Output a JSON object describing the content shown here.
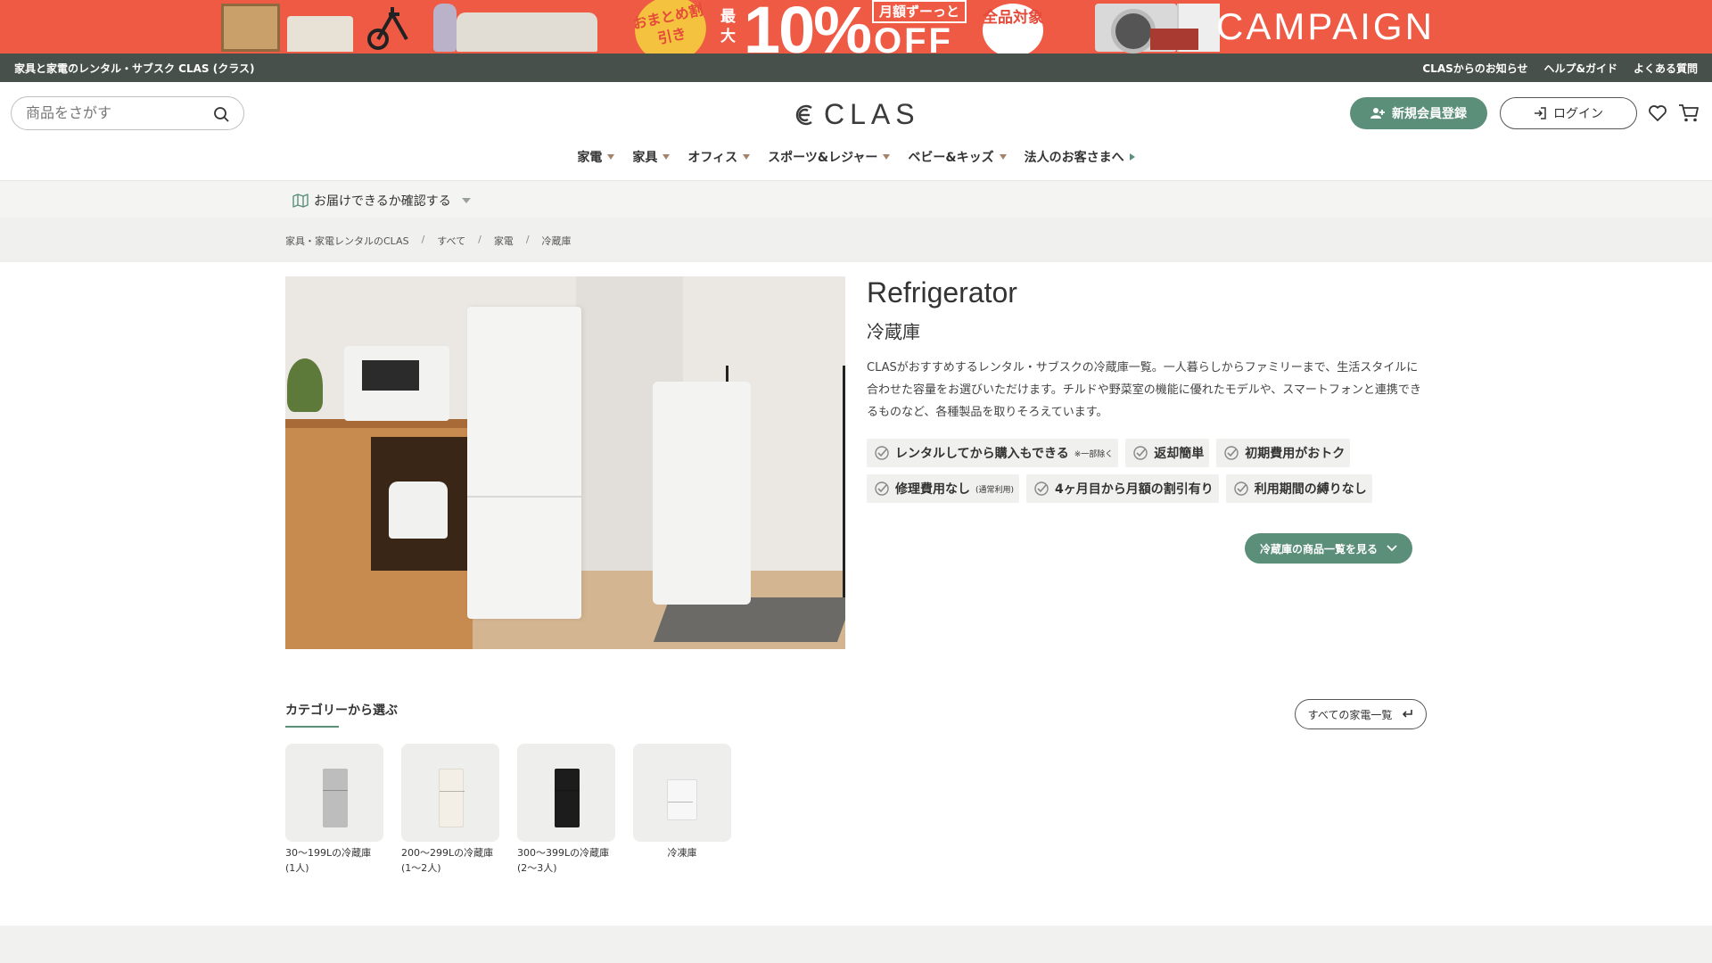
{
  "banner": {
    "bulk_discount": "おまとめ割引き",
    "max": "最大",
    "percent": "10%",
    "monthly": "月額ずーっと",
    "off": "OFF",
    "all_items": "全品対象",
    "campaign": "CAMPAIGN",
    "background": "#ef5a45"
  },
  "topbar": {
    "tagline": "家具と家電のレンタル・サブスク CLAS (クラス)",
    "links": [
      "CLASからのお知らせ",
      "ヘルプ&ガイド",
      "よくある質問"
    ]
  },
  "header": {
    "search_placeholder": "商品をさがす",
    "logo_text": "CLAS",
    "signup_label": "新規会員登録",
    "login_label": "ログイン",
    "accent_color": "#5b8f7a"
  },
  "nav": {
    "items": [
      "家電",
      "家具",
      "オフィス",
      "スポーツ&レジャー",
      "ベビー&キッズ"
    ],
    "business": "法人のお客さまへ"
  },
  "delivery": {
    "label": "お届けできるか確認する"
  },
  "breadcrumb": [
    "家具・家電レンタルのCLAS",
    "すべて",
    "家電",
    "冷蔵庫"
  ],
  "product": {
    "title_en": "Refrigerator",
    "title_ja": "冷蔵庫",
    "description": "CLASがおすすめするレンタル・サブスクの冷蔵庫一覧。一人暮らしからファミリーまで、生活スタイルに合わせた容量をお選びいただけます。チルドや野菜室の機能に優れたモデルや、スマートフォンと連携できるものなど、各種製品を取りそろえています。",
    "features": [
      {
        "label": "レンタルしてから購入もできる",
        "note": "※一部除く"
      },
      {
        "label": "返却簡単",
        "note": ""
      },
      {
        "label": "初期費用がおトク",
        "note": ""
      },
      {
        "label": "修理費用なし",
        "note": "(通常利用)"
      },
      {
        "label": "4ヶ月目から月額の割引有り",
        "note": ""
      },
      {
        "label": "利用期間の縛りなし",
        "note": ""
      }
    ],
    "list_button": "冷蔵庫の商品一覧を見る"
  },
  "categories": {
    "heading": "カテゴリーから選ぶ",
    "all_button": "すべての家電一覧",
    "items": [
      {
        "line1": "30〜199Lの冷蔵庫",
        "line2": "(1人)",
        "color": "#bdbdbd"
      },
      {
        "line1": "200〜299Lの冷蔵庫",
        "line2": "(1〜2人)",
        "color": "#f3efe6"
      },
      {
        "line1": "300〜399Lの冷蔵庫",
        "line2": "(2〜3人)",
        "color": "#1c1c1c"
      },
      {
        "line1": "冷凍庫",
        "line2": "",
        "color": "#f7f7f7"
      }
    ]
  }
}
